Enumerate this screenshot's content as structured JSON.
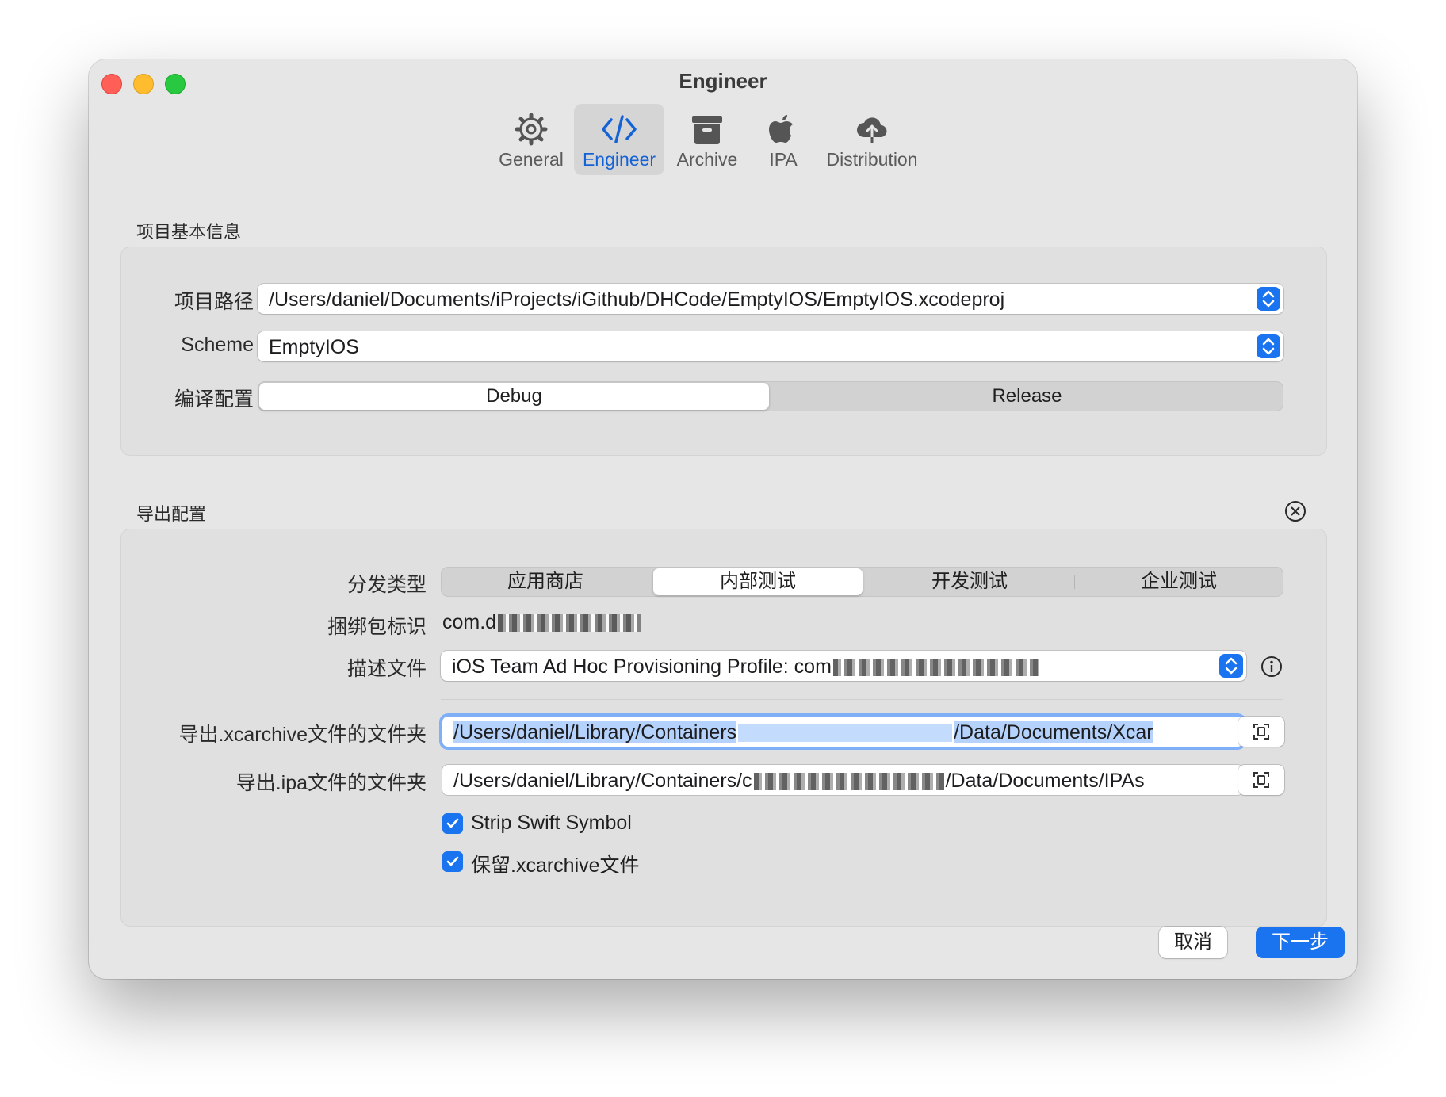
{
  "window": {
    "title": "Engineer"
  },
  "toolbar": {
    "tabs": [
      {
        "label": "General",
        "icon": "gear-icon",
        "active": false
      },
      {
        "label": "Engineer",
        "icon": "code-icon",
        "active": true
      },
      {
        "label": "Archive",
        "icon": "archive-box-icon",
        "active": false
      },
      {
        "label": "IPA",
        "icon": "apple-icon",
        "active": false
      },
      {
        "label": "Distribution",
        "icon": "cloud-upload-icon",
        "active": false
      }
    ]
  },
  "project_info": {
    "title": "项目基本信息",
    "path_label": "项目路径",
    "path_value": "/Users/daniel/Documents/iProjects/iGithub/DHCode/EmptyIOS/EmptyIOS.xcodeproj",
    "scheme_label": "Scheme",
    "scheme_value": "EmptyIOS",
    "build_config_label": "编译配置",
    "build_configs": [
      "Debug",
      "Release"
    ],
    "build_config_selected": "Debug"
  },
  "export_config": {
    "title": "导出配置",
    "distribution_label": "分发类型",
    "distribution_options": [
      "应用商店",
      "内部测试",
      "开发测试",
      "企业测试"
    ],
    "distribution_selected": "内部测试",
    "bundle_id_label": "捆绑包标识",
    "bundle_id_value": "com.d",
    "profile_label": "描述文件",
    "profile_value": "iOS Team Ad Hoc Provisioning Profile: com",
    "xcarchive_folder_label": "导出.xcarchive文件的文件夹",
    "xcarchive_folder_prefix": "/Users/daniel/Library/Containers",
    "xcarchive_folder_suffix": "/Data/Documents/Xcar",
    "ipa_folder_label": "导出.ipa文件的文件夹",
    "ipa_folder_prefix": "/Users/daniel/Library/Containers/c",
    "ipa_folder_suffix": "/Data/Documents/IPAs",
    "strip_swift_symbol_label": "Strip Swift Symbol",
    "strip_swift_symbol_checked": true,
    "keep_xcarchive_label": "保留.xcarchive文件",
    "keep_xcarchive_checked": true
  },
  "footer": {
    "cancel_label": "取消",
    "next_label": "下一步"
  },
  "colors": {
    "accent": "#1a73ef",
    "window_bg": "#e6e6e6",
    "group_bg": "#e0e0e0"
  }
}
